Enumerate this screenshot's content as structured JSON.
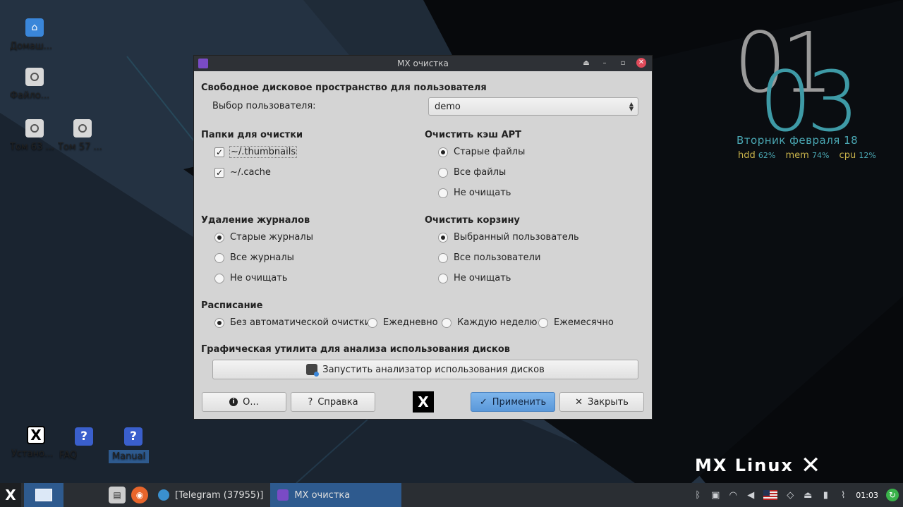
{
  "desktop": {
    "icons": [
      {
        "label": "Домаш...",
        "icon": "home-folder-icon"
      },
      {
        "label": "Файло...",
        "icon": "filesystem-icon"
      },
      {
        "label": "Том 63 ...",
        "icon": "drive-icon"
      },
      {
        "label": "Том 57 ...",
        "icon": "drive-icon"
      },
      {
        "label": "Устано...",
        "icon": "mx-installer-icon"
      },
      {
        "label": "FAQ",
        "icon": "help-icon"
      },
      {
        "label": "Manual",
        "icon": "help-icon"
      }
    ],
    "conky": {
      "hour": "01",
      "minute": "03",
      "date": "Вторник  февраля 18",
      "hdd_label": "hdd",
      "hdd_value": "62%",
      "mem_label": "mem",
      "mem_value": "74%",
      "cpu_label": "cpu",
      "cpu_value": "12%"
    },
    "logo_text": "MX Linux"
  },
  "dialog": {
    "title": "MX очистка",
    "section_free_space": "Свободное дисковое пространство для пользователя",
    "user_select_label": "Выбор пользователя:",
    "user_select_value": "demo",
    "section_folders": "Папки для очистки",
    "folders": [
      {
        "label": "~/.thumbnails",
        "checked": true
      },
      {
        "label": "~/.cache",
        "checked": true
      }
    ],
    "section_apt": "Очистить кэш APT",
    "apt_options": [
      "Старые файлы",
      "Все файлы",
      "Не очищать"
    ],
    "apt_selected": 0,
    "section_logs": "Удаление журналов",
    "log_options": [
      "Старые журналы",
      "Все журналы",
      "Не очищать"
    ],
    "log_selected": 0,
    "section_trash": "Очистить корзину",
    "trash_options": [
      "Выбранный пользователь",
      "Все пользователи",
      "Не очищать"
    ],
    "trash_selected": 0,
    "section_schedule": "Расписание",
    "schedule_options": [
      "Без автоматической очистки",
      "Ежедневно",
      "Каждую неделю",
      "Ежемесячно"
    ],
    "schedule_selected": 0,
    "section_disk_tool": "Графическая утилита для анализа использования дисков",
    "disk_analyzer_button": "Запустить анализатор использования дисков",
    "about_button": "О...",
    "help_button": "Справка",
    "apply_button": "Применить",
    "close_button": "Закрыть"
  },
  "taskbar": {
    "tasks": [
      {
        "label": "[Telegram (37955)]",
        "active": false
      },
      {
        "label": "MX очистка",
        "active": true
      }
    ],
    "clock": "01:03"
  }
}
